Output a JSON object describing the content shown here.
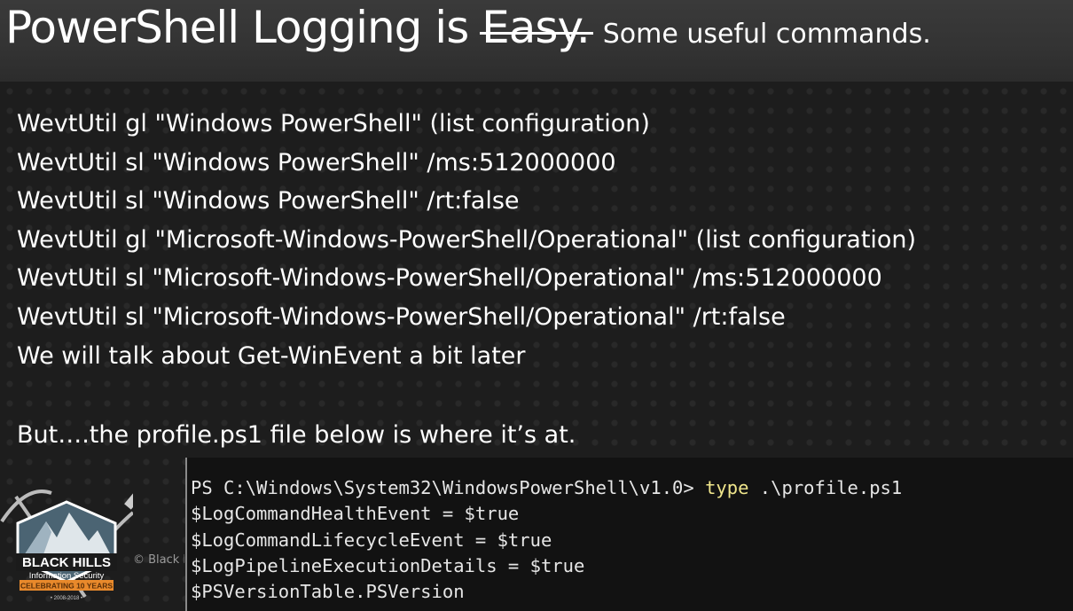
{
  "header": {
    "title_main": "PowerShell Logging is",
    "title_struck": "Easy.",
    "subtitle": "Some useful commands."
  },
  "commands": [
    "WevtUtil gl \"Windows PowerShell\" (list configuration)",
    "WevtUtil sl \"Windows PowerShell\" /ms:512000000",
    "WevtUtil sl \"Windows PowerShell\" /rt:false",
    "WevtUtil gl \"Microsoft-Windows-PowerShell/Operational\" (list configuration)",
    "WevtUtil sl \"Microsoft-Windows-PowerShell/Operational\" /ms:512000000",
    "WevtUtil sl \"Microsoft-Windows-PowerShell/Operational\" /rt:false",
    "We will talk about Get-WinEvent a bit later"
  ],
  "after_text": "But….the profile.ps1 file below is where it’s at.",
  "console": {
    "prompt": "PS C:\\Windows\\System32\\WindowsPowerShell\\v1.0>",
    "command": "type",
    "argument": ".\\profile.ps1",
    "lines": [
      "$LogCommandHealthEvent = $true",
      "$LogCommandLifecycleEvent = $true",
      "$LogPipelineExecutionDetails = $true",
      "$PSVersionTable.PSVersion"
    ]
  },
  "logo": {
    "name_line1": "BLACK HILLS",
    "name_line2": "Information Security",
    "banner": "CELEBRATING 10 YEARS",
    "years": "• 2008-2018 •",
    "accent_color": "#e8892b"
  },
  "copyright": "© Black Hills"
}
